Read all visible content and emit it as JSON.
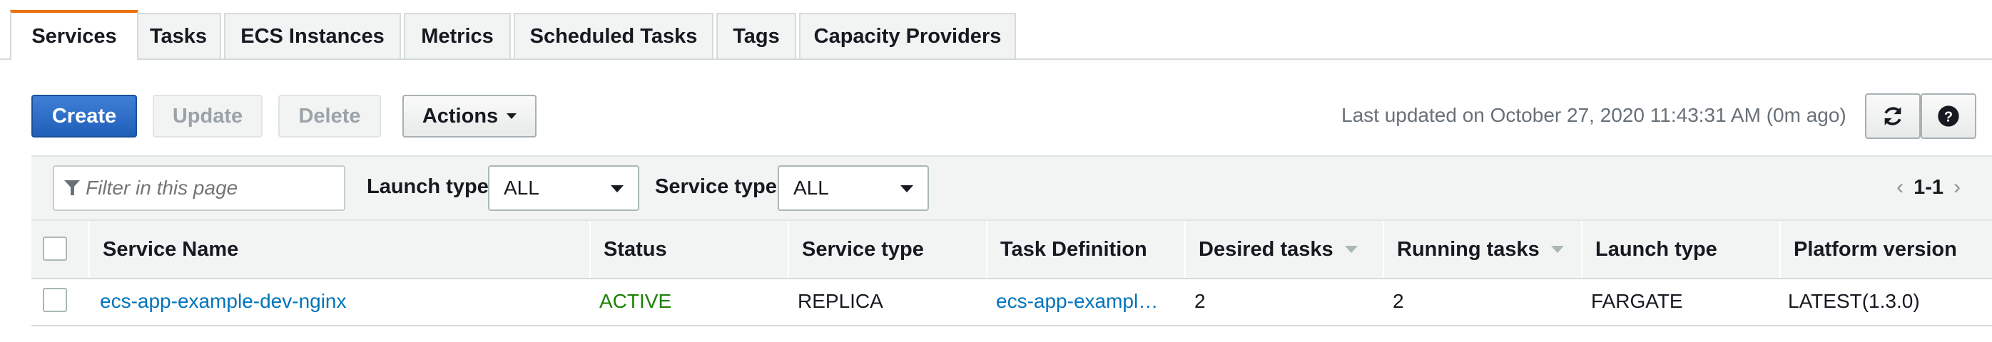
{
  "tabs": [
    "Services",
    "Tasks",
    "ECS Instances",
    "Metrics",
    "Scheduled Tasks",
    "Tags",
    "Capacity Providers"
  ],
  "active_tab": "Services",
  "toolbar": {
    "create_label": "Create",
    "update_label": "Update",
    "delete_label": "Delete",
    "actions_label": "Actions",
    "last_updated": "Last updated on October 27, 2020 11:43:31 AM (0m ago)"
  },
  "icons": {
    "refresh": "refresh-icon",
    "help": "help-icon",
    "filter": "filter-icon"
  },
  "filters": {
    "search_placeholder": "Filter in this page",
    "launch_type_label": "Launch type",
    "launch_type_value": "ALL",
    "service_type_label": "Service type",
    "service_type_value": "ALL"
  },
  "pagination": {
    "range": "1-1"
  },
  "table": {
    "columns": [
      "Service Name",
      "Status",
      "Service type",
      "Task Definition",
      "Desired tasks",
      "Running tasks",
      "Launch type",
      "Platform version"
    ],
    "rows": [
      {
        "service_name": "ecs-app-example-dev-nginx",
        "status": "ACTIVE",
        "service_type": "REPLICA",
        "task_definition": "ecs-app-exampl…",
        "desired_tasks": "2",
        "running_tasks": "2",
        "launch_type": "FARGATE",
        "platform_version": "LATEST(1.3.0)"
      }
    ]
  },
  "colors": {
    "accent_tab": "#ec7211",
    "primary_button": "#1f5fb8",
    "link": "#0073bb",
    "status_active": "#1d8102"
  }
}
